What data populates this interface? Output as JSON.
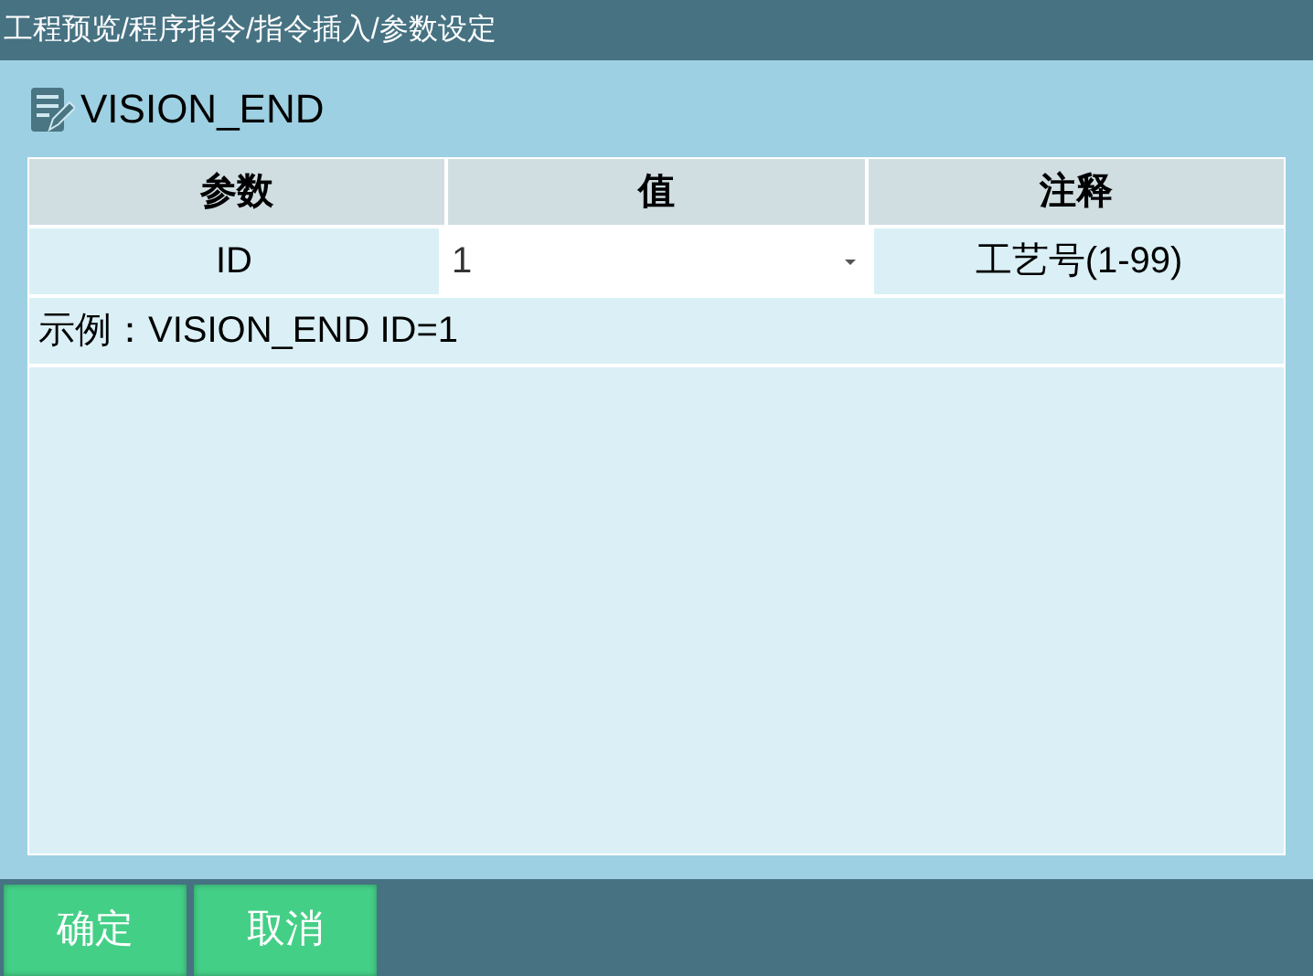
{
  "breadcrumb": "工程预览/程序指令/指令插入/参数设定",
  "instruction": "VISION_END",
  "table": {
    "columns": [
      "参数",
      "值",
      "注释"
    ],
    "rows": [
      {
        "param": "ID",
        "value": "1",
        "comment": "工艺号(1-99)"
      }
    ],
    "example": "示例：VISION_END ID=1"
  },
  "buttons": [
    "确定",
    "取消"
  ]
}
